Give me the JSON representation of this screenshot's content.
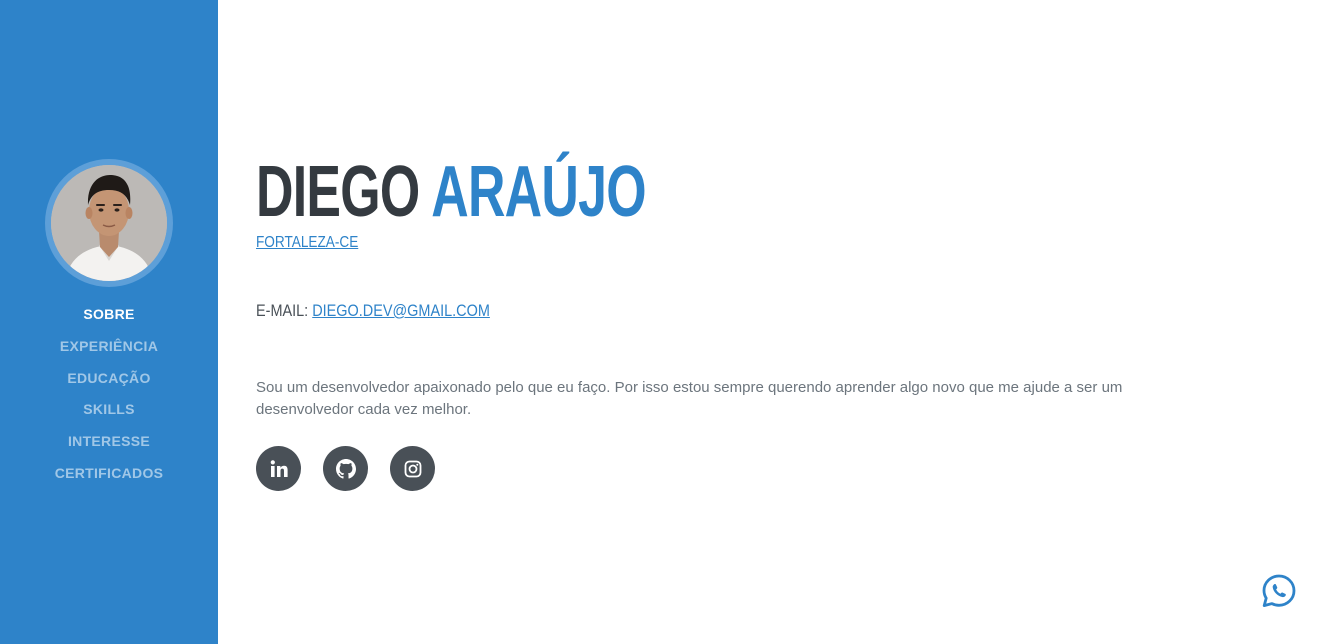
{
  "sidebar": {
    "nav": [
      {
        "label": "SOBRE",
        "active": true
      },
      {
        "label": "EXPERIÊNCIA",
        "active": false
      },
      {
        "label": "EDUCAÇÃO",
        "active": false
      },
      {
        "label": "SKILLS",
        "active": false
      },
      {
        "label": "INTERESSE",
        "active": false
      },
      {
        "label": "CERTIFICADOS",
        "active": false
      }
    ],
    "bg_color": "#2e83c9"
  },
  "profile": {
    "first_name": "DIEGO",
    "last_name": "ARAÚJO",
    "location": "FORTALEZA-CE",
    "email_label": "E-MAIL:",
    "email": "DIEGO.DEV@GMAIL.COM",
    "bio": "Sou um desenvolvedor apaixonado pelo que eu faço. Por isso estou sempre querendo aprender algo novo que me ajude a ser um desenvolvedor cada vez melhor."
  },
  "socials": [
    {
      "icon": "linkedin-icon"
    },
    {
      "icon": "github-icon"
    },
    {
      "icon": "instagram-icon"
    }
  ],
  "floating": {
    "icon": "whatsapp-icon"
  },
  "colors": {
    "accent": "#2e83c9",
    "dark": "#343a40",
    "social_bg": "#495057"
  }
}
